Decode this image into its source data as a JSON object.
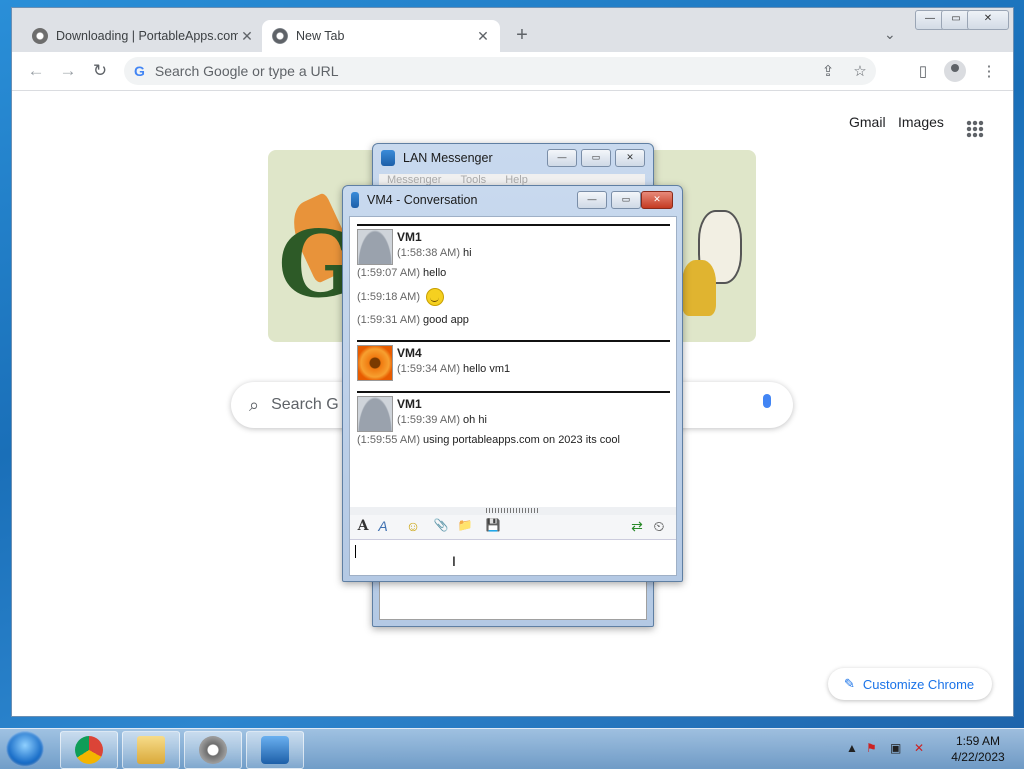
{
  "browser": {
    "tabs": [
      {
        "title": "Downloading | PortableApps.com",
        "close": "✕"
      },
      {
        "title": "New Tab",
        "close": "✕"
      }
    ],
    "new_tab": "+",
    "tab_list": "⌄",
    "window_controls": {
      "minimize": "—",
      "maximize": "▭",
      "close": "✕"
    },
    "nav": {
      "back": "←",
      "forward": "→",
      "reload": "↻"
    },
    "omnibox": {
      "g_mark": "G",
      "placeholder": "Search Google or type a URL"
    },
    "toolbar_icons": {
      "share": "⇪",
      "bookmark": "☆",
      "side_panel": "▯",
      "menu": "⋮"
    }
  },
  "ntp": {
    "gmail": "Gmail",
    "images": "Images",
    "search_placeholder": "Search G",
    "customize": "Customize Chrome",
    "customize_icon": "✎"
  },
  "lan_messenger": {
    "title": "LAN Messenger",
    "menu": [
      "Messenger",
      "Tools",
      "Help"
    ]
  },
  "conversation": {
    "title": "VM4 - Conversation",
    "blocks": [
      {
        "sender": "VM1",
        "avatar": "default-user",
        "messages": [
          {
            "time": "(1:59:07 AM)",
            "text": "hello"
          },
          {
            "time": "(1:59:18 AM)",
            "text": "",
            "emoji": "smiley"
          },
          {
            "time": "(1:59:31 AM)",
            "text": "good app"
          }
        ],
        "first": {
          "time": "(1:58:38 AM)",
          "text": "hi"
        }
      },
      {
        "sender": "VM4",
        "avatar": "flower",
        "first": {
          "time": "(1:59:34 AM)",
          "text": "hello vm1"
        }
      },
      {
        "sender": "VM1",
        "avatar": "default-user",
        "first": {
          "time": "(1:59:39 AM)",
          "text": "oh hi"
        },
        "messages": [
          {
            "time": "(1:59:55 AM)",
            "text": "using portableapps.com on 2023 its cool"
          }
        ]
      }
    ],
    "format_toolbar": {
      "font": "A",
      "font_color": "A",
      "emoticon": "☺",
      "attach_file": "📎",
      "attach_folder": "📁",
      "save": "💾",
      "transfers": "⇄",
      "history": "⏲"
    },
    "input_value": ""
  },
  "taskbar": {
    "apps": [
      "chrome",
      "explorer",
      "portableapps",
      "lan-messenger"
    ],
    "tray_up": "▲",
    "clock_time": "1:59 AM",
    "clock_date": "4/22/2023"
  }
}
